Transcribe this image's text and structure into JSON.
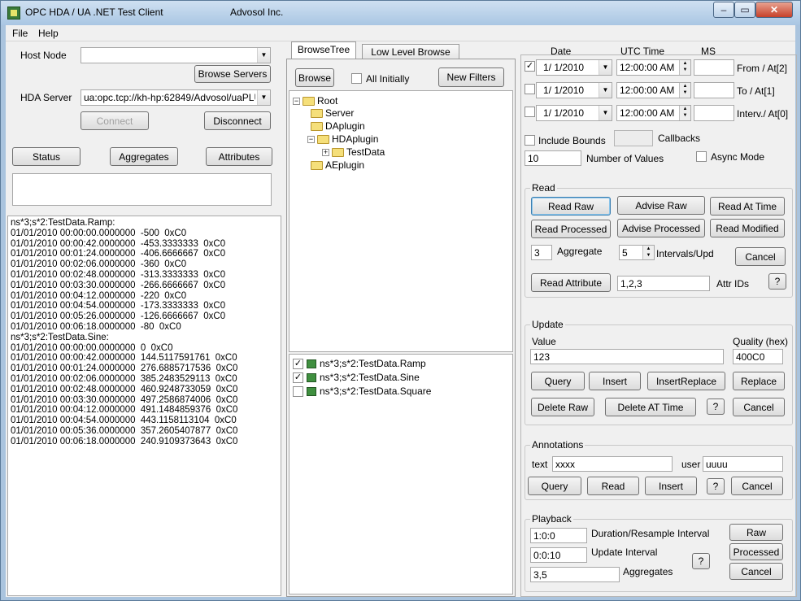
{
  "window": {
    "title": "OPC HDA / UA .NET Test Client",
    "company": "Advosol Inc.",
    "minimize": "–",
    "maximize": "▭",
    "close": "✕"
  },
  "menu": [
    "File",
    "Help"
  ],
  "left": {
    "host_node_label": "Host Node",
    "host_node_value": "",
    "browse_servers": "Browse Servers",
    "hda_server_label": "HDA Server",
    "hda_server_value": "ua:opc.tcp://kh-hp:62849/Advosol/uaPLUS",
    "connect": "Connect",
    "disconnect": "Disconnect",
    "status": "Status",
    "aggregates": "Aggregates",
    "attributes": "Attributes",
    "status_text": "",
    "log": [
      "ns*3;s*2:TestData.Ramp:",
      "01/01/2010 00:00:00.0000000  -500  0xC0",
      "01/01/2010 00:00:42.0000000  -453.3333333  0xC0",
      "01/01/2010 00:01:24.0000000  -406.6666667  0xC0",
      "01/01/2010 00:02:06.0000000  -360  0xC0",
      "01/01/2010 00:02:48.0000000  -313.3333333  0xC0",
      "01/01/2010 00:03:30.0000000  -266.6666667  0xC0",
      "01/01/2010 00:04:12.0000000  -220  0xC0",
      "01/01/2010 00:04:54.0000000  -173.3333333  0xC0",
      "01/01/2010 00:05:26.0000000  -126.6666667  0xC0",
      "01/01/2010 00:06:18.0000000  -80  0xC0",
      "ns*3;s*2:TestData.Sine:",
      "01/01/2010 00:00:00.0000000  0  0xC0",
      "01/01/2010 00:00:42.0000000  144.5117591761  0xC0",
      "01/01/2010 00:01:24.0000000  276.6885717536  0xC0",
      "01/01/2010 00:02:06.0000000  385.2483529113  0xC0",
      "01/01/2010 00:02:48.0000000  460.9248733059  0xC0",
      "01/01/2010 00:03:30.0000000  497.2586874006  0xC0",
      "01/01/2010 00:04:12.0000000  491.1484859376  0xC0",
      "01/01/2010 00:04:54.0000000  443.1158113104  0xC0",
      "01/01/2010 00:05:36.0000000  357.2605407877  0xC0",
      "01/01/2010 00:06:18.0000000  240.9109373643  0xC0"
    ]
  },
  "middle": {
    "tabs": [
      "BrowseTree",
      "Low Level Browse"
    ],
    "browse": "Browse",
    "all_initially": "All Initially",
    "new_filters": "New Filters",
    "tree": {
      "root": "Root",
      "items": [
        "Server",
        "DAplugin",
        "HDAplugin",
        "TestData",
        "AEplugin"
      ]
    },
    "tags": [
      {
        "name": "ns*3;s*2:TestData.Ramp",
        "checked": true
      },
      {
        "name": "ns*3;s*2:TestData.Sine",
        "checked": true
      },
      {
        "name": "ns*3;s*2:TestData.Square",
        "checked": false
      }
    ]
  },
  "right": {
    "headers": {
      "date": "Date",
      "utc_time": "UTC  Time",
      "ms": "MS"
    },
    "rows": [
      {
        "checked": true,
        "date": "1/  1/2010",
        "time": "12:00:00 AM",
        "ms": "",
        "label": "From  / At[2]"
      },
      {
        "checked": false,
        "date": "1/  1/2010",
        "time": "12:00:00 AM",
        "ms": "",
        "label": "To    / At[1]"
      },
      {
        "checked": false,
        "date": "1/  1/2010",
        "time": "12:00:00 AM",
        "ms": "",
        "label": "Interv./ At[0]"
      }
    ],
    "include_bounds": "Include Bounds",
    "callbacks": "Callbacks",
    "num_values": "10",
    "num_values_label": "Number of Values",
    "async_mode": "Async Mode",
    "read": {
      "title": "Read",
      "read_raw": "Read Raw",
      "advise_raw": "Advise Raw",
      "read_at_time": "Read At Time",
      "read_processed": "Read Processed",
      "advise_processed": "Advise Processed",
      "read_modified": "Read Modified",
      "aggregate_value": "3",
      "aggregate_label": "Aggregate",
      "intervals_value": "5",
      "intervals_label": "Intervals/Upd",
      "cancel": "Cancel",
      "read_attribute": "Read Attribute",
      "attr_ids_value": "1,2,3",
      "attr_ids_label": "Attr IDs",
      "help": "?"
    },
    "update": {
      "title": "Update",
      "value_label": "Value",
      "quality_label": "Quality (hex)",
      "value": "123",
      "quality": "400C0",
      "query": "Query",
      "insert": "Insert",
      "insert_replace": "InsertReplace",
      "replace": "Replace",
      "delete_raw": "Delete Raw",
      "delete_at_time": "Delete AT Time",
      "help": "?",
      "cancel": "Cancel"
    },
    "annotations": {
      "title": "Annotations",
      "text_label": "text",
      "text_value": "xxxx",
      "user_label": "user",
      "user_value": "uuuu",
      "query": "Query",
      "read": "Read",
      "insert": "Insert",
      "help": "?",
      "cancel": "Cancel"
    },
    "playback": {
      "title": "Playback",
      "duration_value": "1:0:0",
      "duration_label": "Duration/Resample Interval",
      "update_value": "0:0:10",
      "update_label": "Update Interval",
      "aggregates_value": "3,5",
      "aggregates_label": "Aggregates",
      "raw": "Raw",
      "processed": "Processed",
      "cancel": "Cancel",
      "help": "?"
    }
  }
}
